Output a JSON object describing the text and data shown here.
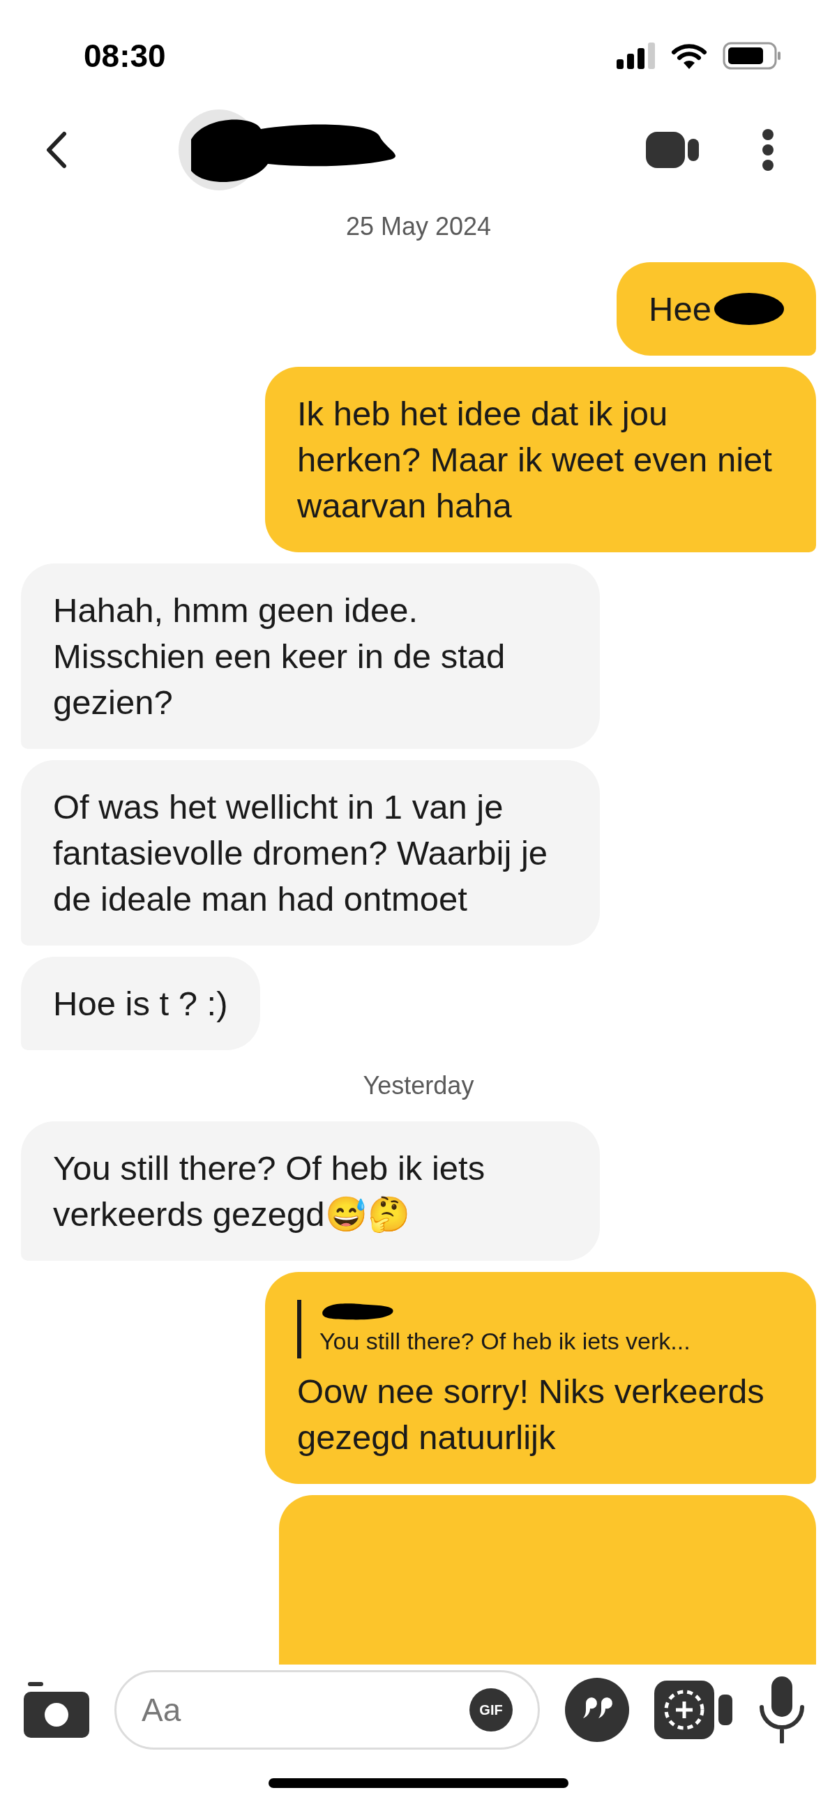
{
  "status_bar": {
    "time": "08:30"
  },
  "messages": [
    {
      "kind": "date",
      "text": "25 May 2024"
    },
    {
      "kind": "sent",
      "text": "Hee",
      "redacted_end": true
    },
    {
      "kind": "sent",
      "text": "Ik heb het idee dat ik jou herken? Maar ik weet even niet waarvan haha"
    },
    {
      "kind": "received",
      "text": "Hahah, hmm geen idee. Misschien een keer in de stad gezien?"
    },
    {
      "kind": "received",
      "text": "Of was het wellicht in 1 van je fantasievolle dromen? Waarbij je de ideale man had ontmoet"
    },
    {
      "kind": "received",
      "text": "Hoe is t ? :)"
    },
    {
      "kind": "date",
      "text": "Yesterday"
    },
    {
      "kind": "received",
      "text": "You still there? Of heb ik iets verkeerds gezegd😅🤔"
    },
    {
      "kind": "sent",
      "quote": "You still there? Of heb ik iets verk...",
      "text": "Oow nee sorry! Niks verkeerds gezegd natuurlijk"
    },
    {
      "kind": "sent_cut"
    }
  ],
  "composer": {
    "placeholder": "Aa",
    "gif": "GIF"
  }
}
